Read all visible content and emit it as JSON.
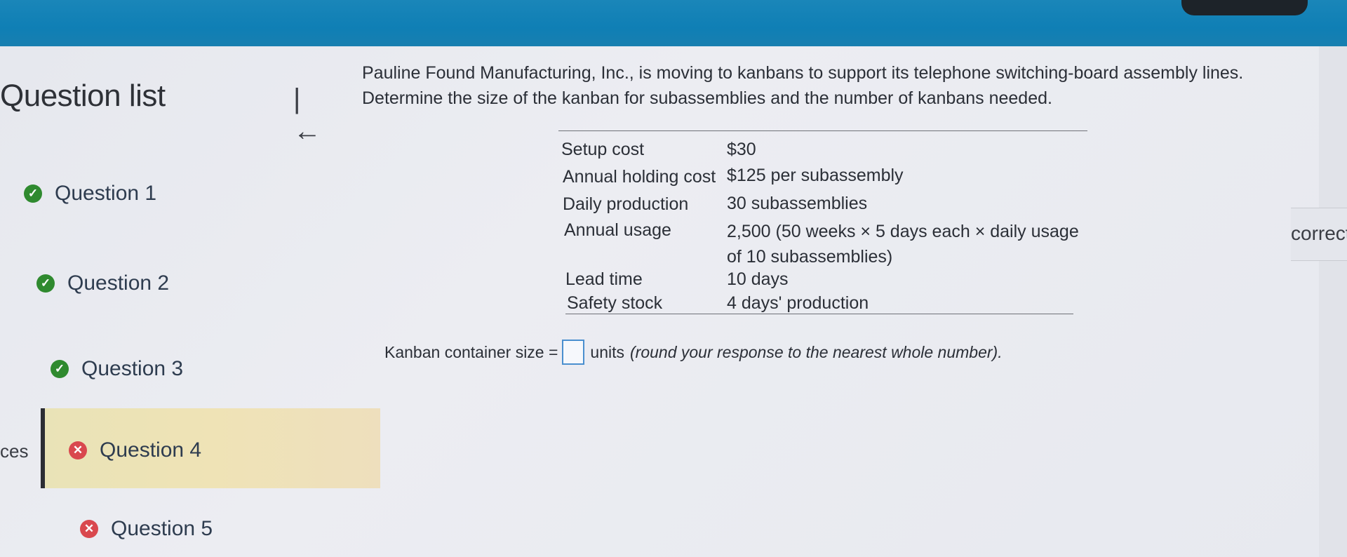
{
  "sidebar": {
    "title": "Question list",
    "partial_left_text": "ces",
    "questions": [
      {
        "label": "Question 1",
        "status": "correct"
      },
      {
        "label": "Question 2",
        "status": "correct"
      },
      {
        "label": "Question 3",
        "status": "correct"
      },
      {
        "label": "Question 4",
        "status": "incorrect"
      },
      {
        "label": "Question 5",
        "status": "incorrect"
      }
    ],
    "active_question": "Question 4"
  },
  "right_edge_text": "correct",
  "problem": {
    "prompt_line1": "Pauline Found Manufacturing, Inc., is moving to kanbans to support its telephone switching-board assembly lines.",
    "prompt_line2": "Determine the size of the kanban for subassemblies and the number of kanbans needed.",
    "table": [
      {
        "label": "Setup cost",
        "value": "$30"
      },
      {
        "label": "Annual holding cost",
        "value": "$125 per subassembly"
      },
      {
        "label": "Daily production",
        "value": "30 subassemblies"
      },
      {
        "label": "Annual usage",
        "value": "2,500 (50 weeks × 5 days each × daily usage",
        "value_cont": "of 10 subassemblies)"
      },
      {
        "label": "Lead time",
        "value": "10 days"
      },
      {
        "label": "Safety stock",
        "value": "4 days' production"
      }
    ],
    "answer_prefix": "Kanban container size =",
    "answer_unit": "units",
    "answer_note": "(round your response to the nearest whole number)."
  },
  "icons": {
    "collapse": "collapse-left-icon",
    "correct": "check-circle-icon",
    "incorrect": "x-circle-icon"
  },
  "colors": {
    "header": "#1283b8",
    "correct": "#2f8a2f",
    "incorrect": "#d9484e",
    "active_row": "#ece2b7",
    "answer_box_border": "#4a8fcf"
  }
}
